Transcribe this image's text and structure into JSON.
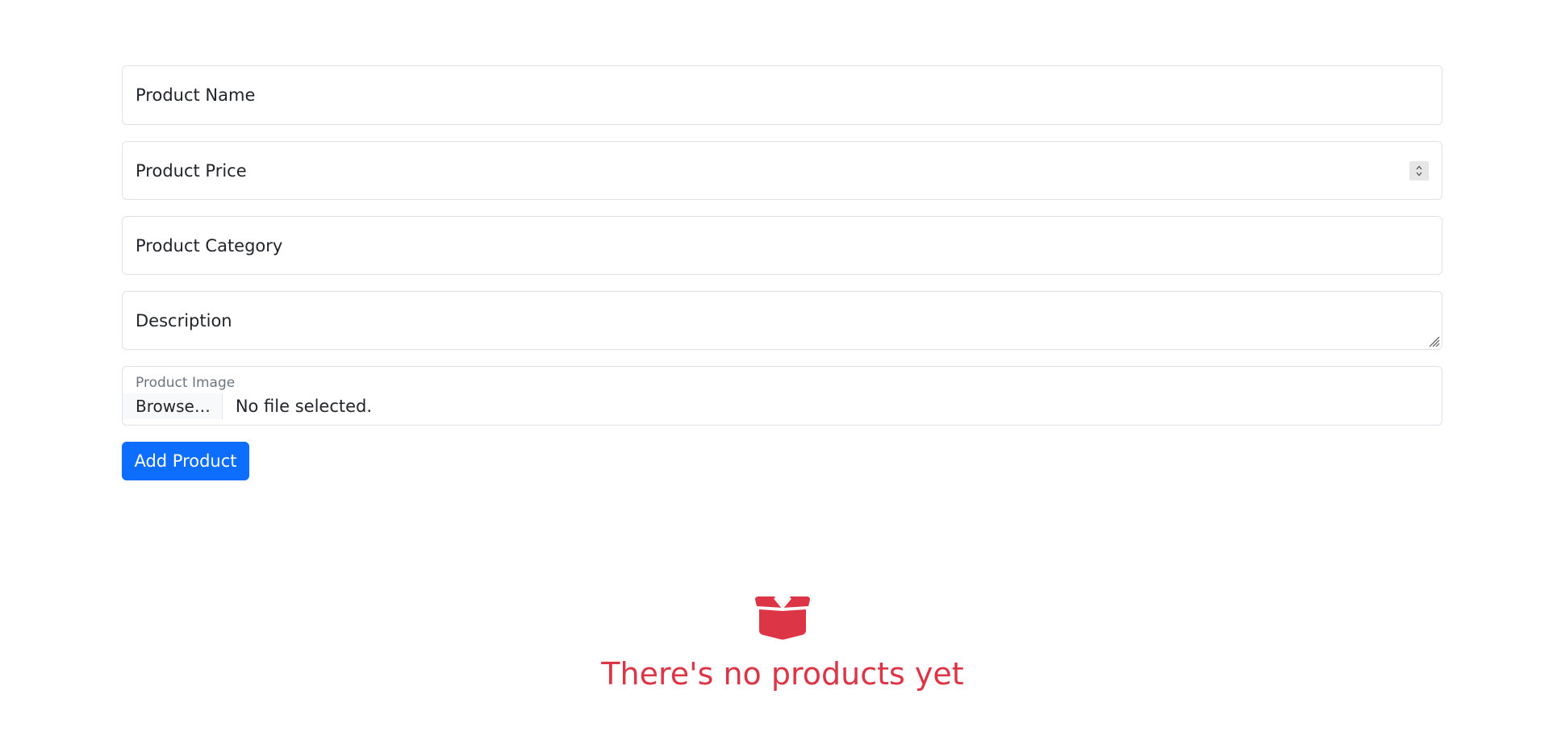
{
  "form": {
    "product_name_placeholder": "Product Name",
    "product_price_placeholder": "Product Price",
    "product_category_placeholder": "Product Category",
    "description_placeholder": "Description",
    "product_image_label": "Product Image",
    "browse_label": "Browse…",
    "file_status": "No file selected.",
    "add_button_label": "Add Product"
  },
  "empty_state": {
    "icon": "open-box-icon",
    "message": "There's no products yet",
    "color": "#dc3545"
  },
  "colors": {
    "primary": "#0d6efd",
    "danger": "#dc3545",
    "border": "#dee2e6"
  }
}
